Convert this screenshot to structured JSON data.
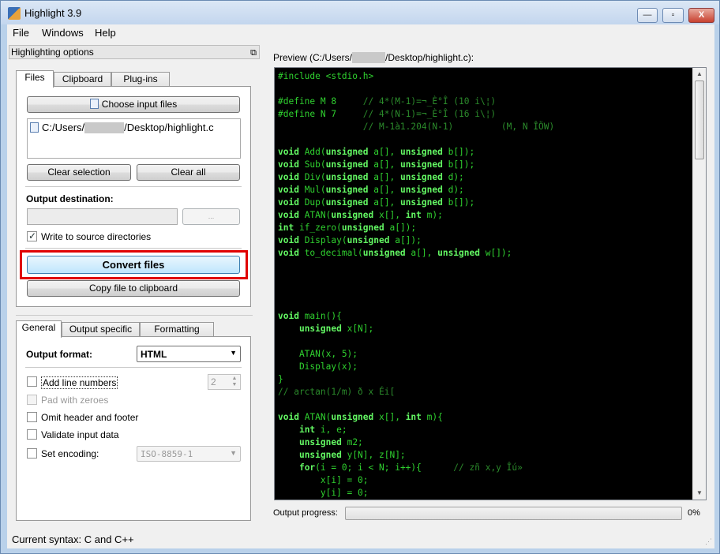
{
  "window": {
    "title": "Highlight 3.9",
    "minimize": "—",
    "maximize": "▫",
    "close": "X"
  },
  "menu": [
    "File",
    "Windows",
    "Help"
  ],
  "dock": {
    "title": "Highlighting options",
    "float_icon": "⧉"
  },
  "top_tabs": [
    "Files",
    "Clipboard",
    "Plug-ins"
  ],
  "files": {
    "choose_button": "Choose input files",
    "list_item_prefix": "C:/Users/",
    "list_item_suffix": "/Desktop/highlight.c",
    "clear_selection": "Clear selection",
    "clear_all": "Clear all",
    "output_destination_label": "Output destination:",
    "browse_button": "...",
    "write_to_source_label": "Write to source directories",
    "write_to_source_checked": true,
    "convert_button": "Convert files",
    "copy_button": "Copy file to clipboard"
  },
  "bottom_tabs": [
    "General",
    "Output specific",
    "Formatting"
  ],
  "general": {
    "output_format_label": "Output format:",
    "output_format_value": "HTML",
    "add_line_numbers": "Add line numbers",
    "line_number_width": "2",
    "pad_with_zeroes": "Pad with zeroes",
    "omit_header_footer": "Omit header and footer",
    "validate_input": "Validate input data",
    "set_encoding": "Set encoding:",
    "encoding_value": "ISO-8859-1"
  },
  "preview": {
    "label_prefix": "Preview (C:/Users/",
    "label_suffix": "/Desktop/highlight.c):"
  },
  "progress": {
    "label": "Output progress:",
    "value": 0,
    "percent_text": "0%"
  },
  "status": {
    "current_syntax": "Current syntax: C and C++"
  },
  "colors": {
    "highlight_frame": "#e00000",
    "code_background": "#000000",
    "code_text": "#2fd12f"
  }
}
